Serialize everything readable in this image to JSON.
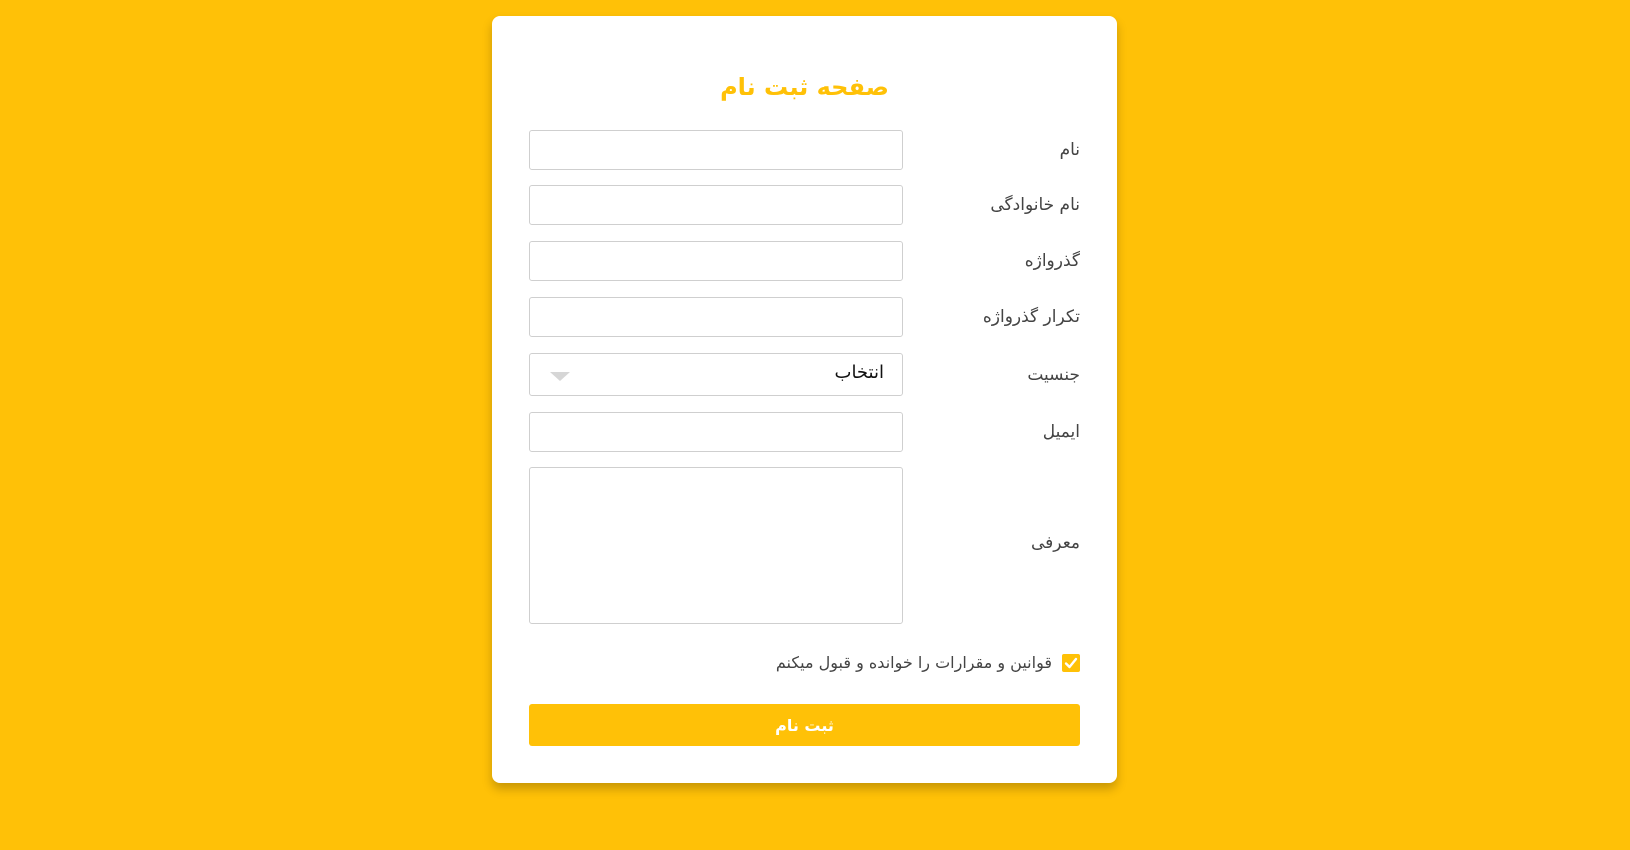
{
  "form": {
    "title": "صفحه ثبت نام",
    "fields": [
      {
        "label": "نام",
        "value": ""
      },
      {
        "label": "نام خانوادگی",
        "value": ""
      },
      {
        "label": "گذرواژه",
        "value": ""
      },
      {
        "label": "تکرار گذرواژه",
        "value": ""
      },
      {
        "label": "جنسیت",
        "selected": "انتخاب"
      },
      {
        "label": "ایمیل",
        "value": ""
      },
      {
        "label": "معرفی",
        "value": ""
      }
    ],
    "terms": {
      "label": "قوانین و مقرارات را خوانده و قبول میکنم",
      "checked": true
    },
    "submit_label": "ثبت نام"
  },
  "colors": {
    "accent": "#ffc107",
    "card": "#ffffff",
    "label": "#444444",
    "border": "#cfcfcf"
  }
}
